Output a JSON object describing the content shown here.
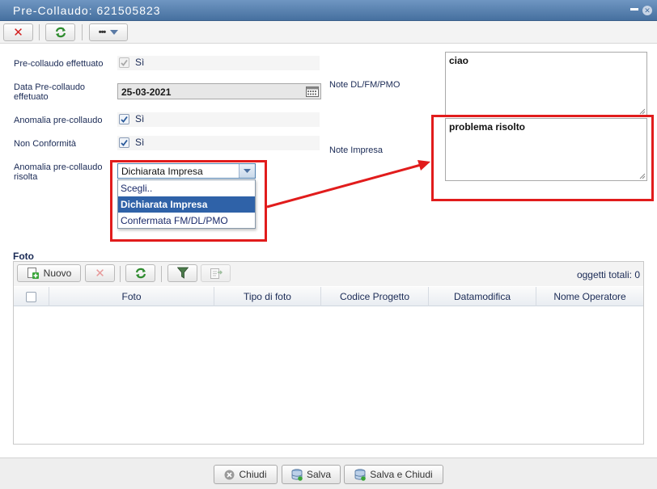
{
  "window": {
    "title": "Pre-Collaudo: 621505823"
  },
  "toolbar": {
    "more_label": "•••"
  },
  "form": {
    "pre_collaudo_effettuato": {
      "label": "Pre-collaudo effettuato",
      "checked": true,
      "value_text": "Sì"
    },
    "data_pre_collaudo": {
      "label_line1": "Data Pre-collaudo",
      "label_line2": "effetuato",
      "value": "25-03-2021"
    },
    "anomalia_pre_collaudo": {
      "label": "Anomalia pre-collaudo",
      "checked": true,
      "value_text": "Sì"
    },
    "non_conformita": {
      "label": "Non Conformità",
      "checked": true,
      "value_text": "Sì"
    },
    "anomalia_risolta": {
      "label_line1": "Anomalia pre-collaudo",
      "label_line2": "risolta",
      "selected": "Dichiarata Impresa",
      "options": [
        "Scegli..",
        "Dichiarata Impresa",
        "Confermata FM/DL/PMO"
      ]
    },
    "note_dl": {
      "label": "Note DL/FM/PMO",
      "value": "ciao"
    },
    "note_impresa": {
      "label": "Note Impresa",
      "value": "problema risolto"
    }
  },
  "foto": {
    "section_title": "Foto",
    "new_label": "Nuovo",
    "totals_label": "oggetti totali: 0",
    "columns": [
      "Foto",
      "Tipo di foto",
      "Codice Progetto",
      "Datamodifica",
      "Nome Operatore"
    ],
    "rows": []
  },
  "footer": {
    "chiudi_label": "Chiudi",
    "salva_label": "Salva",
    "salva_chiudi_label": "Salva e Chiudi"
  },
  "colors": {
    "title_bar": "#46709f",
    "highlight_red": "#e11c1c",
    "selected_option": "#2f62a8"
  }
}
